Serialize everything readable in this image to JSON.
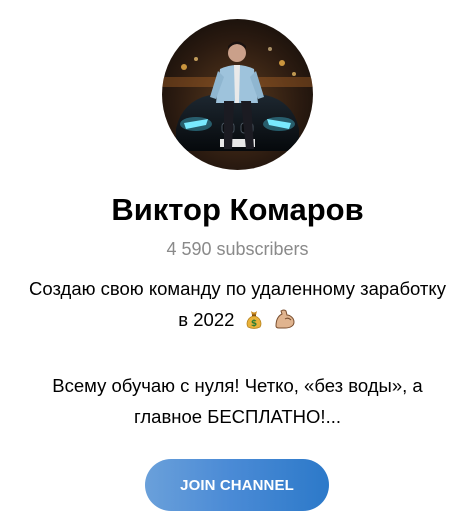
{
  "channel": {
    "name": "Виктор Комаров",
    "subscribers": "4 590 subscribers"
  },
  "description": {
    "line1": "Создаю свою команду по удаленному заработку",
    "line2": "в 2022",
    "line2_emojis": [
      "money-bag-icon",
      "flexed-biceps-icon"
    ],
    "line3": "Всему обучаю с нуля! Четко, «без воды», а",
    "line4": "главное БЕСПЛАТНО!..."
  },
  "actions": {
    "join_label": "JOIN CHANNEL"
  },
  "colors": {
    "button_gradient_start": "#6aa0da",
    "button_gradient_end": "#2c79c9",
    "subscribers_text": "#8a8a8a",
    "title_text": "#000000"
  }
}
